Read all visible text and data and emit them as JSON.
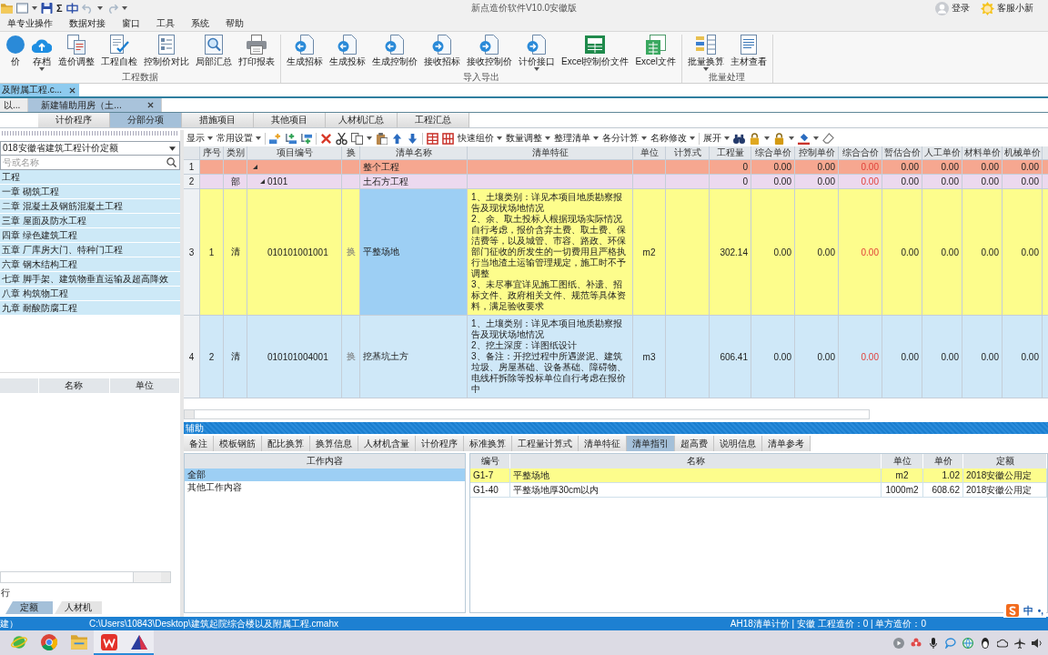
{
  "title_bar": {
    "sum_symbol": "Σ",
    "undo_disabled": true,
    "redo_disabled": true,
    "app_title": "新点造价软件V10.0安徽版",
    "login": "登录",
    "service": "客服小新"
  },
  "menu": [
    "单专业操作",
    "数据对接",
    "窗口",
    "工具",
    "系统",
    "帮助"
  ],
  "ribbon": [
    {
      "label": "工程数据",
      "buttons": [
        {
          "label": "价",
          "dropdown": false
        },
        {
          "label": "存档",
          "dropdown": true
        },
        {
          "label": "造价调整",
          "dropdown": false
        },
        {
          "label": "工程自检",
          "dropdown": false
        },
        {
          "label": "控制价对比",
          "dropdown": false
        },
        {
          "label": "局部汇总",
          "dropdown": false
        },
        {
          "label": "打印报表",
          "dropdown": false
        }
      ]
    },
    {
      "label": "导入导出",
      "buttons": [
        {
          "label": "生成招标",
          "dropdown": false
        },
        {
          "label": "生成投标",
          "dropdown": false
        },
        {
          "label": "生成控制价",
          "dropdown": false
        },
        {
          "label": "接收招标",
          "dropdown": false
        },
        {
          "label": "接收控制价",
          "dropdown": false
        },
        {
          "label": "计价接口",
          "dropdown": true
        },
        {
          "label": "Excel控制价文件",
          "dropdown": false
        },
        {
          "label": "Excel文件",
          "dropdown": false
        }
      ]
    },
    {
      "label": "批量处理",
      "buttons": [
        {
          "label": "批量换算",
          "dropdown": true
        },
        {
          "label": "主材查看",
          "dropdown": false
        }
      ]
    }
  ],
  "doc_tabs": [
    {
      "label": "及附属工程.c...",
      "selected": true
    }
  ],
  "sub_tabs": [
    {
      "label": "以...",
      "selected": false
    },
    {
      "label": "新建辅助用房（土...",
      "selected": true
    }
  ],
  "module_tabs": [
    {
      "label": "计价程序",
      "selected": false
    },
    {
      "label": "分部分项",
      "selected": true
    },
    {
      "label": "措施项目",
      "selected": false
    },
    {
      "label": "其他项目",
      "selected": false
    },
    {
      "label": "人材机汇总",
      "selected": false
    },
    {
      "label": "工程汇总",
      "selected": false
    }
  ],
  "left_panel": {
    "library": "018安徽省建筑工程计价定额",
    "search": {
      "placeholder": "号或名称"
    },
    "chapters": [
      "工程",
      "一章 砌筑工程",
      "二章 混凝土及钢筋混凝土工程",
      "三章 屋面及防水工程",
      "四章 绿色建筑工程",
      "五章 厂库房大门、特种门工程",
      "六章 钢木结构工程",
      "七章 脚手架、建筑物垂直运输及超高降效",
      "八章 构筑物工程",
      "九章 耐酸防腐工程"
    ],
    "list_columns": [
      "名称",
      "单位"
    ],
    "rows_label": "行",
    "tabs": [
      {
        "label": "定额",
        "selected": true
      },
      {
        "label": "人材机",
        "selected": false
      }
    ]
  },
  "table_toolbar": {
    "edit_menus": [
      "显示",
      "常用设置"
    ],
    "price_menus": [
      "快速组价",
      "数量调整",
      "整理清单",
      "各分计算",
      "名称修改"
    ],
    "view_menus": [
      "展开"
    ]
  },
  "table": {
    "columns": [
      "序号",
      "类别",
      "项目编号",
      "换",
      "清单名称",
      "清单特征",
      "单位",
      "计算式",
      "工程量",
      "综合单价",
      "控制单价",
      "综合合价",
      "暂估合价",
      "人工单价",
      "材料单价",
      "机械单价"
    ],
    "rows": [
      {
        "row_number": "1",
        "kind": "project",
        "selected": false,
        "expanded": true,
        "name": "整个工程",
        "quantity": "0",
        "prices": [
          "0.00",
          "0.00",
          "0.00",
          "0.00",
          "0.00",
          "0.00",
          "0.00"
        ],
        "children": [
          {
            "row_number": "2",
            "kind": "division",
            "selected": false,
            "expanded": true,
            "type": "部",
            "code": "0101",
            "name": "土石方工程",
            "quantity": "0",
            "prices": [
              "0.00",
              "0.00",
              "0.00",
              "0.00",
              "0.00",
              "0.00",
              "0.00"
            ],
            "children": [
              {
                "row_number": "3",
                "kind": "item",
                "selected": true,
                "no": "1",
                "type": "清",
                "code": "010101001001",
                "swap": "换",
                "name": "平整场地",
                "features": "1、土壤类别：详见本项目地质勘察报告及现状场地情况\n2、余、取土投标人根据现场实际情况自行考虑，报价含弃土费、取土费、保洁费等，以及城管、市容、路政、环保部门征收的所发生的一切费用且严格执行当地渣土运输管理规定，施工时不予调整\n3、未尽事宜详见施工图纸、补遗、招标文件、政府相关文件、规范等具体资料，满足验收要求",
                "unit": "m2",
                "quantity": "302.14",
                "prices": [
                  "0.00",
                  "0.00",
                  "0.00",
                  "0.00",
                  "0.00",
                  "0.00",
                  "0.00"
                ]
              },
              {
                "row_number": "4",
                "kind": "item",
                "selected": false,
                "no": "2",
                "type": "清",
                "code": "010101004001",
                "swap": "换",
                "name": "挖基坑土方",
                "features": "1、土壤类别：详见本项目地质勘察报告及现状场地情况\n2、挖土深度：详图纸设计\n3、备注：开挖过程中所遇淤泥、建筑垃圾、房屋基础、设备基础、障碍物、电线杆拆除等投标单位自行考虑在报价中",
                "unit": "m3",
                "quantity": "606.41",
                "prices": [
                  "0.00",
                  "0.00",
                  "0.00",
                  "0.00",
                  "0.00",
                  "0.00",
                  "0.00"
                ]
              }
            ]
          }
        ]
      }
    ]
  },
  "assist": {
    "title": "辅助",
    "tabs": [
      {
        "label": "备注",
        "selected": false
      },
      {
        "label": "模板钢筋",
        "selected": false
      },
      {
        "label": "配比换算",
        "selected": false
      },
      {
        "label": "换算信息",
        "selected": false
      },
      {
        "label": "人材机含量",
        "selected": false
      },
      {
        "label": "计价程序",
        "selected": false
      },
      {
        "label": "标准换算",
        "selected": false
      },
      {
        "label": "工程量计算式",
        "selected": false
      },
      {
        "label": "清单特征",
        "selected": false
      },
      {
        "label": "清单指引",
        "selected": true
      },
      {
        "label": "超高费",
        "selected": false
      },
      {
        "label": "说明信息",
        "selected": false
      },
      {
        "label": "清单参考",
        "selected": false
      }
    ],
    "work_content": {
      "header": "工作内容",
      "items": [
        {
          "label": "全部",
          "selected": true
        },
        {
          "label": "其他工作内容",
          "selected": false
        }
      ]
    },
    "norms": {
      "columns": [
        "编号",
        "名称",
        "单位",
        "单价",
        "定额"
      ],
      "rows": [
        {
          "selected": true,
          "code": "G1-7",
          "name": "平整场地",
          "unit": "m2",
          "price": "1.02",
          "library": "2018安徽公用定"
        },
        {
          "selected": false,
          "code": "G1-40",
          "name": "平整场地厚30cm以内",
          "unit": "1000m2",
          "price": "608.62",
          "library": "2018安徽公用定"
        }
      ]
    }
  },
  "status_bar": {
    "mode": "建）",
    "path": "C:\\Users\\10843\\Desktop\\建筑起院综合楼以及附属工程.cmahx",
    "info": "AH18清单计价 | 安徽 工程造价：0 | 单方造价：0"
  },
  "ime": {
    "mode": "中",
    "punctuation": "•,"
  },
  "taskbar": [
    {
      "running": false
    },
    {
      "running": false
    },
    {
      "running": false
    },
    {
      "running": true
    },
    {
      "running": true
    }
  ]
}
